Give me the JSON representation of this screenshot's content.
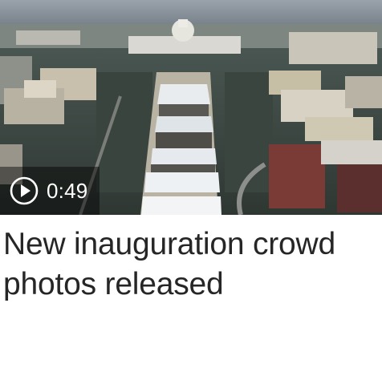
{
  "video": {
    "duration": "0:49",
    "play_icon": "play-circle-icon",
    "thumbnail_icon": "aerial-photo"
  },
  "headline": "New inauguration crowd photos released",
  "colors": {
    "headline_text": "#262626",
    "badge_text": "#ffffff",
    "badge_background": "rgba(0,0,0,0.45)"
  }
}
